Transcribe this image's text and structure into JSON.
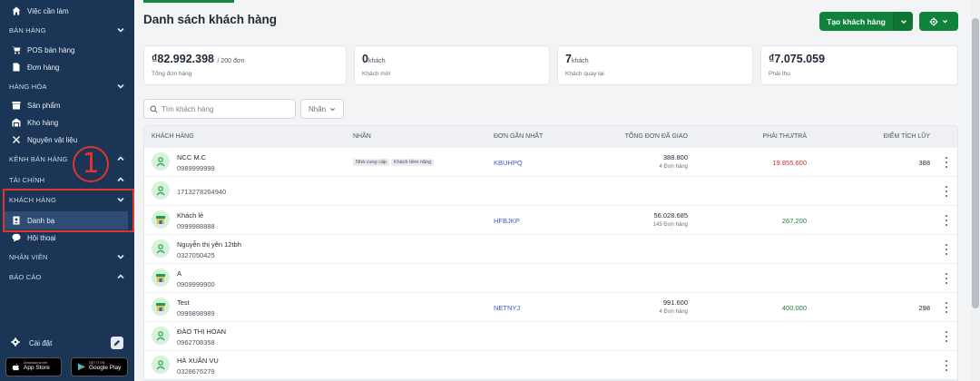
{
  "sidebar": {
    "top_item": "Việc cần làm",
    "sections": {
      "ban_hang": "BÁN HÀNG",
      "hang_hoa": "HÀNG HÓA",
      "kenh_ban_hang": "KÊNH BÁN HÀNG",
      "tai_chinh": "TÀI CHÍNH",
      "khach_hang": "KHÁCH HÀNG",
      "nhan_vien": "NHÂN VIÊN",
      "bao_cao": "BÁO CÁO"
    },
    "items": {
      "pos": "POS bán hàng",
      "don_hang": "Đơn hàng",
      "san_pham": "Sản phẩm",
      "kho_hang": "Kho hàng",
      "nguyen_vat_lieu": "Nguyên vật liệu",
      "danh_ba": "Danh bạ",
      "hoi_thoai": "Hội thoại"
    },
    "settings": "Cài đặt",
    "app_store": {
      "small": "Download on the",
      "big": "App Store"
    },
    "google_play": {
      "small": "GET IT ON",
      "big": "Google Play"
    },
    "annotation_number": "1"
  },
  "header": {
    "title": "Danh sách khách hàng",
    "create_button": "Tạo khách hàng"
  },
  "stats": [
    {
      "value": "₫82.992.398",
      "unit": "/ 200 đơn",
      "label": "Tổng đơn hàng"
    },
    {
      "value": "0",
      "unit": "khách",
      "label": "Khách mới"
    },
    {
      "value": "7",
      "unit": "khách",
      "label": "Khách quay lại"
    },
    {
      "value": "₫7.075.059",
      "unit": "",
      "label": "Phải thu"
    }
  ],
  "filters": {
    "search_placeholder": "Tìm khách hàng",
    "tag_filter": "Nhãn"
  },
  "table": {
    "columns": [
      "KHÁCH HÀNG",
      "NHÃN",
      "ĐƠN GẦN NHẤT",
      "TỔNG ĐƠN ĐÃ GIAO",
      "PHẢI THU/TRẢ",
      "ĐIỂM TÍCH LŨY"
    ],
    "rows": [
      {
        "name": "NCC M.C",
        "phone": "0989999999",
        "tags": [
          "Nhà cung cấp",
          "Khách tiềm năng"
        ],
        "order": "KBUHPQ",
        "total": "388.800",
        "count": "4 Đơn hàng",
        "payable": "19.855.600",
        "payable_color": "#dc2626",
        "points": "388"
      },
      {
        "name": "",
        "phone": "1713278264940",
        "tags": [],
        "order": "",
        "total": "",
        "count": "",
        "payable": "",
        "points": ""
      },
      {
        "name": "Khách lẻ",
        "phone": "0999988888",
        "tags": [],
        "order": "HFBJKP",
        "total": "56.028.685",
        "count": "145 Đơn hàng",
        "payable": "267.200",
        "payable_color": "#15803d",
        "points": ""
      },
      {
        "name": "Nguyễn thị yên 12tbh",
        "phone": "0327050425",
        "tags": [],
        "order": "",
        "total": "",
        "count": "",
        "payable": "",
        "points": ""
      },
      {
        "name": "A",
        "phone": "0909999900",
        "tags": [],
        "order": "",
        "total": "",
        "count": "",
        "payable": "",
        "points": ""
      },
      {
        "name": "Test",
        "phone": "0999898989",
        "tags": [],
        "order": "NETNYJ",
        "total": "991.600",
        "count": "4 Đơn hàng",
        "payable": "400.000",
        "payable_color": "#15803d",
        "points": "298"
      },
      {
        "name": "ĐÀO THỊ HOAN",
        "phone": "0962708358",
        "tags": [],
        "order": "",
        "total": "",
        "count": "",
        "payable": "",
        "points": ""
      },
      {
        "name": "HÀ XUÂN VỤ",
        "phone": "0328676279",
        "tags": [],
        "order": "",
        "total": "",
        "count": "",
        "payable": "",
        "points": ""
      }
    ]
  },
  "colors": {
    "sidebar_bg": "#1b3556",
    "primary": "#11823b",
    "highlight": "#e0342c"
  }
}
